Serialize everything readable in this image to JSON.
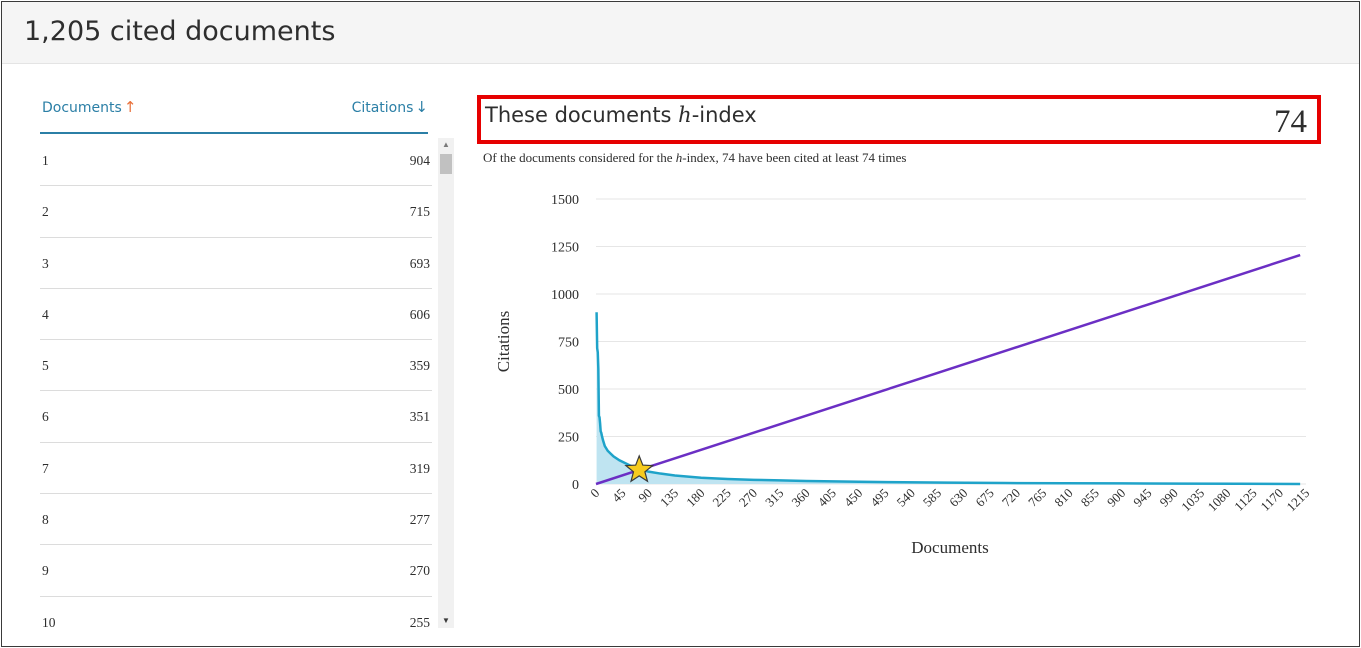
{
  "header": {
    "title": "1,205 cited documents"
  },
  "table": {
    "col_documents": "Documents",
    "col_citations": "Citations",
    "arrow_up": "↑",
    "arrow_down": "↓",
    "rows": [
      {
        "doc": "1",
        "citations": "904"
      },
      {
        "doc": "2",
        "citations": "715"
      },
      {
        "doc": "3",
        "citations": "693"
      },
      {
        "doc": "4",
        "citations": "606"
      },
      {
        "doc": "5",
        "citations": "359"
      },
      {
        "doc": "6",
        "citations": "351"
      },
      {
        "doc": "7",
        "citations": "319"
      },
      {
        "doc": "8",
        "citations": "277"
      },
      {
        "doc": "9",
        "citations": "270"
      },
      {
        "doc": "10",
        "citations": "255"
      }
    ]
  },
  "hindex": {
    "title_prefix": "These documents ",
    "title_h": "h",
    "title_suffix": "-index",
    "value": "74",
    "desc_prefix": "Of the documents considered for the ",
    "desc_h": "h",
    "desc_suffix": "-index, 74 have been cited at least 74 times"
  },
  "chart_data": {
    "type": "area",
    "xlabel": "Documents",
    "ylabel": "Citations",
    "ylim": [
      0,
      1500
    ],
    "xlim": [
      0,
      1215
    ],
    "y_ticks": [
      0,
      250,
      500,
      750,
      1000,
      1250,
      1500
    ],
    "x_ticks": [
      0,
      45,
      90,
      135,
      180,
      225,
      270,
      315,
      360,
      405,
      450,
      495,
      540,
      585,
      630,
      675,
      720,
      765,
      810,
      855,
      900,
      945,
      990,
      1035,
      1080,
      1125,
      1170,
      1215
    ],
    "grid": true,
    "series": [
      {
        "name": "Citations",
        "color": "#1fa3c9",
        "fill": "#bfe4f1",
        "x": [
          1,
          2,
          3,
          4,
          5,
          6,
          7,
          8,
          9,
          10,
          12,
          15,
          20,
          25,
          30,
          40,
          50,
          60,
          74,
          90,
          110,
          135,
          160,
          180,
          225,
          270,
          315,
          360,
          405,
          450,
          500,
          600,
          700,
          800,
          900,
          1000,
          1100,
          1205
        ],
        "y": [
          904,
          715,
          693,
          606,
          359,
          351,
          319,
          277,
          270,
          255,
          230,
          200,
          175,
          160,
          145,
          125,
          110,
          95,
          78,
          65,
          55,
          45,
          38,
          33,
          26,
          22,
          19,
          16,
          14,
          12,
          10,
          7,
          5,
          4,
          3,
          2,
          1,
          0
        ]
      },
      {
        "name": "Documents",
        "color": "#6b2fc4",
        "x": [
          0,
          1205
        ],
        "y": [
          0,
          1205
        ]
      }
    ],
    "h_index_point": {
      "x": 74,
      "y": 74,
      "color": "#f7cb1d"
    }
  }
}
